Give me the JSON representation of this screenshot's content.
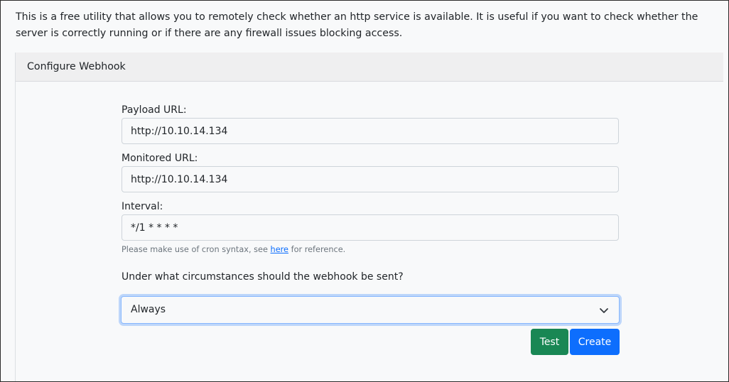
{
  "intro": {
    "text": "This is a free utility that allows you to remotely check whether an http service is available. It is useful if you want to check whether the server is correctly running or if there are any firewall issues blocking access."
  },
  "card": {
    "header": "Configure Webhook"
  },
  "form": {
    "payload_label": "Payload URL:",
    "payload_value": "http://10.10.14.134",
    "monitored_label": "Monitored URL:",
    "monitored_value": "http://10.10.14.134",
    "interval_label": "Interval:",
    "interval_value": "*/1 * * * *",
    "help_prefix": "Please make use of cron syntax, see ",
    "help_link": "here",
    "help_suffix": " for reference.",
    "question": "Under what circumstances should the webhook be sent?",
    "select_value": "Always"
  },
  "buttons": {
    "test": "Test",
    "create": "Create"
  },
  "colors": {
    "test_button": "#198754",
    "create_button": "#0d6efd",
    "link": "#0d6efd"
  },
  "icons": {
    "select_arrow": "chevron-down-icon"
  }
}
